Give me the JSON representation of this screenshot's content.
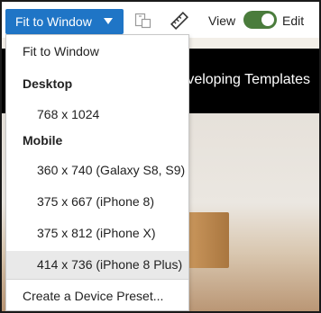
{
  "toolbar": {
    "device_select_label": "Fit to Window",
    "view_label": "View",
    "edit_label": "Edit",
    "mode_toggle_on": true,
    "toggle_color": "#4a7c3c",
    "select_color": "#1f75c6"
  },
  "preview": {
    "title": "veloping Templates"
  },
  "menu": {
    "fit_label": "Fit to Window",
    "desktop_header": "Desktop",
    "desktop_items": [
      "768 x 1024"
    ],
    "mobile_header": "Mobile",
    "mobile_items": [
      "360 x 740 (Galaxy S8, S9)",
      "375 x 667 (iPhone 8)",
      "375 x 812 (iPhone X)",
      "414 x 736 (iPhone 8 Plus)"
    ],
    "highlighted_item": "414 x 736 (iPhone 8 Plus)",
    "create_preset_label": "Create a Device Preset..."
  }
}
